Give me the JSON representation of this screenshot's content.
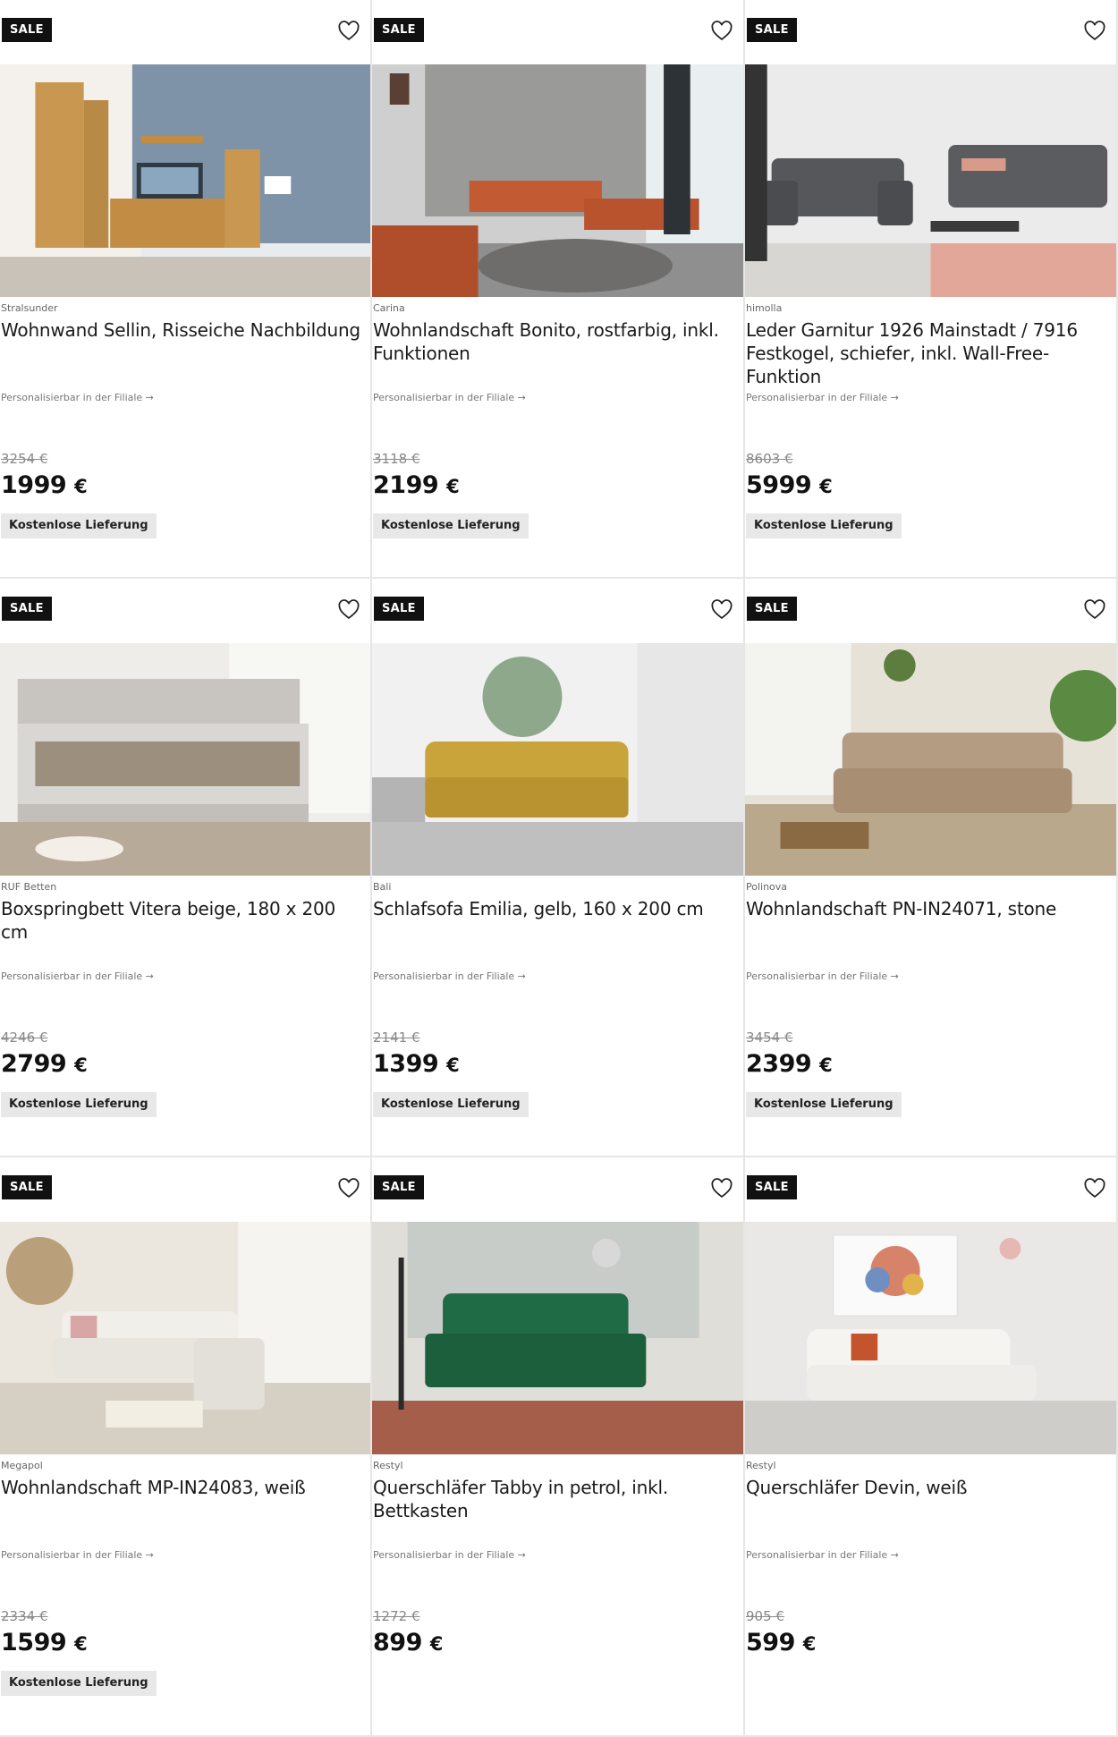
{
  "sale_label": "SALE",
  "personal_label": "Personalisierbar in der Filiale →",
  "currency": "€",
  "delivery_label": "Kostenlose Lieferung",
  "products": [
    {
      "brand": "Stralsunder",
      "title": "Wohnwand Sellin, Risseiche Nachbildung",
      "old_price": "3254 €",
      "price": "1999",
      "delivery": true,
      "scene": "wall"
    },
    {
      "brand": "Carina",
      "title": "Wohnlandschaft Bonito, rostfarbig, inkl. Funktionen",
      "old_price": "3118 €",
      "price": "2199",
      "delivery": true,
      "scene": "corner-rust"
    },
    {
      "brand": "himolla",
      "title": "Leder Garnitur 1926 Mainstadt / 7916 Festkogel, schiefer, inkl. Wall-Free-Funktion",
      "old_price": "8603 €",
      "price": "5999",
      "delivery": true,
      "scene": "leather-grey"
    },
    {
      "brand": "RUF Betten",
      "title": "Boxspringbett Vitera beige, 180 x 200 cm",
      "old_price": "4246 €",
      "price": "2799",
      "delivery": true,
      "scene": "bed"
    },
    {
      "brand": "Bali",
      "title": "Schlafsofa Emilia, gelb, 160 x 200 cm",
      "old_price": "2141 €",
      "price": "1399",
      "delivery": true,
      "scene": "sofa-yellow"
    },
    {
      "brand": "Polinova",
      "title": "Wohnlandschaft PN-IN24071, stone",
      "old_price": "3454 €",
      "price": "2399",
      "delivery": true,
      "scene": "sofa-stone"
    },
    {
      "brand": "Megapol",
      "title": "Wohnlandschaft MP-IN24083, weiß",
      "old_price": "2334 €",
      "price": "1599",
      "delivery": true,
      "scene": "corner-white"
    },
    {
      "brand": "Restyl",
      "title": "Querschläfer Tabby in petrol, inkl. Bettkasten",
      "old_price": "1272 €",
      "price": "899",
      "delivery": false,
      "scene": "sofa-green"
    },
    {
      "brand": "Restyl",
      "title": "Querschläfer Devin, weiß",
      "old_price": "905 €",
      "price": "599",
      "delivery": false,
      "scene": "sofa-white"
    }
  ]
}
